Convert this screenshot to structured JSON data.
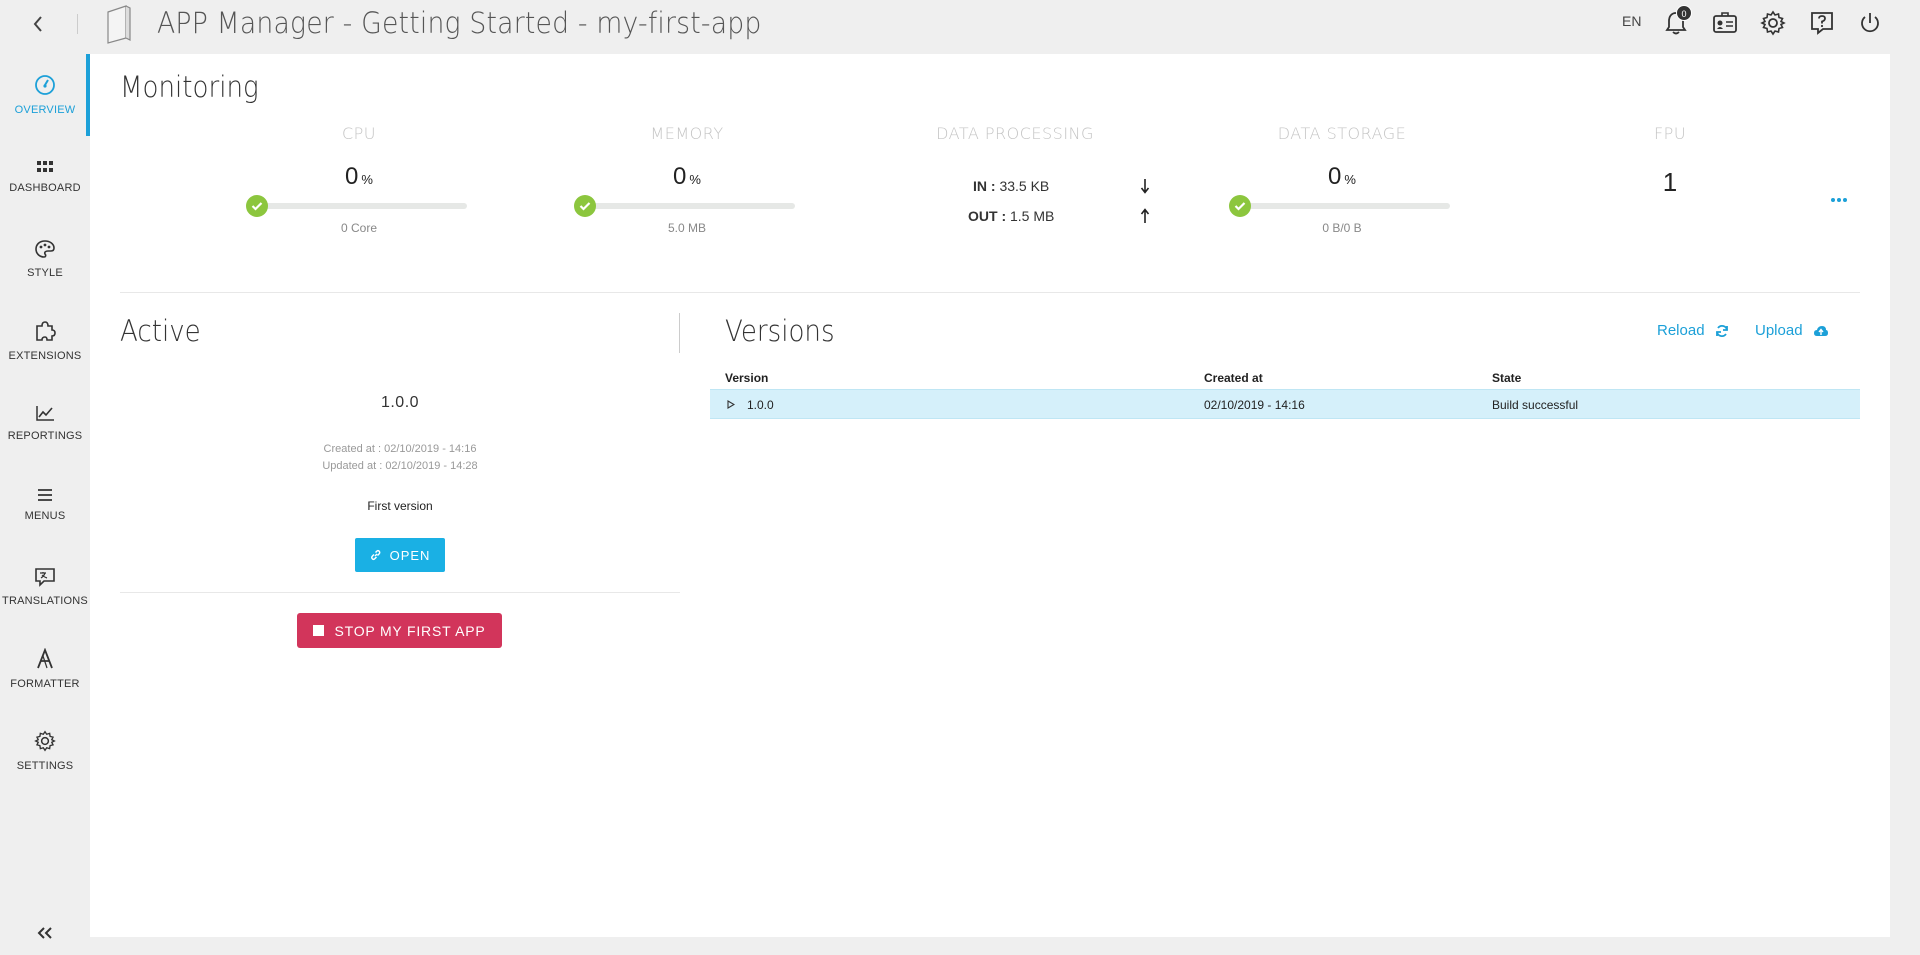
{
  "header": {
    "title": "APP Manager - Getting Started - my-first-app",
    "language": "EN",
    "notification_count": "0"
  },
  "sidebar": {
    "items": [
      {
        "label": "OVERVIEW",
        "icon": "gauge-icon",
        "active": true
      },
      {
        "label": "DASHBOARD",
        "icon": "grid-icon"
      },
      {
        "label": "STYLE",
        "icon": "palette-icon"
      },
      {
        "label": "EXTENSIONS",
        "icon": "puzzle-icon"
      },
      {
        "label": "REPORTINGS",
        "icon": "chart-line-icon"
      },
      {
        "label": "MENUS",
        "icon": "menu-lines-icon"
      },
      {
        "label": "TRANSLATIONS",
        "icon": "translate-icon"
      },
      {
        "label": "FORMATTER",
        "icon": "formatter-icon"
      },
      {
        "label": "SETTINGS",
        "icon": "gear-icon"
      }
    ]
  },
  "monitoring": {
    "title": "Monitoring",
    "cpu": {
      "title": "CPU",
      "value": "0",
      "unit": "%",
      "sub": "0 Core"
    },
    "memory": {
      "title": "MEMORY",
      "value": "0",
      "unit": "%",
      "sub": "5.0 MB"
    },
    "data_processing": {
      "title": "DATA PROCESSING",
      "in_label": "IN :",
      "in_value": "33.5 KB",
      "out_label": "OUT :",
      "out_value": "1.5 MB"
    },
    "data_storage": {
      "title": "DATA STORAGE",
      "value": "0",
      "unit": "%",
      "sub": "0 B/0 B"
    },
    "fpu": {
      "title": "FPU",
      "value": "1"
    }
  },
  "active": {
    "title": "Active",
    "version": "1.0.0",
    "created": "Created at : 02/10/2019 - 14:16",
    "updated": "Updated at : 02/10/2019 - 14:28",
    "description": "First version",
    "open_label": "OPEN",
    "stop_label": "STOP MY FIRST APP"
  },
  "versions": {
    "title": "Versions",
    "reload_label": "Reload",
    "upload_label": "Upload",
    "columns": [
      "Version",
      "Created at",
      "State"
    ],
    "rows": [
      {
        "version": "1.0.0",
        "created": "02/10/2019 - 14:16",
        "state": "Build successful"
      }
    ]
  },
  "colors": {
    "accent": "#1ca0d8",
    "success": "#8cc63e",
    "danger": "#d2355b",
    "row_highlight": "#d5f0fa"
  }
}
